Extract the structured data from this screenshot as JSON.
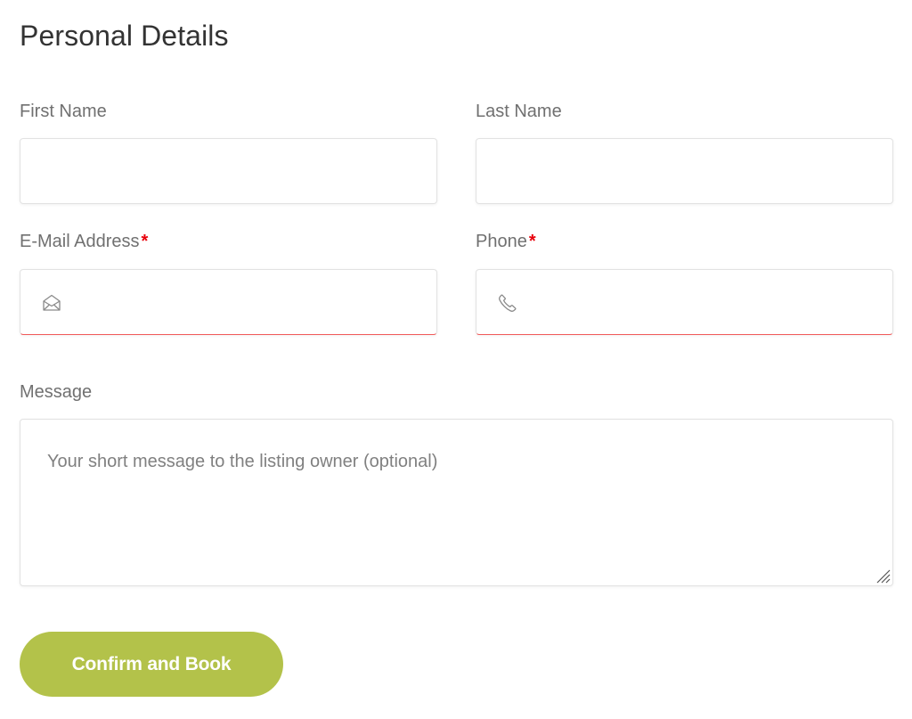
{
  "form": {
    "title": "Personal Details",
    "first_name": {
      "label": "First Name",
      "value": "",
      "placeholder": ""
    },
    "last_name": {
      "label": "Last Name",
      "value": "",
      "placeholder": ""
    },
    "email": {
      "label": "E-Mail Address",
      "required_mark": "*",
      "value": "",
      "placeholder": "",
      "icon": "envelope-icon"
    },
    "phone": {
      "label": "Phone",
      "required_mark": "*",
      "value": "",
      "placeholder": "",
      "icon": "phone-icon"
    },
    "message": {
      "label": "Message",
      "placeholder": "Your short message to the listing owner (optional)",
      "value": ""
    },
    "submit_label": "Confirm and Book"
  },
  "colors": {
    "accent": "#b3c24a",
    "required": "#e8000b",
    "invalid_border": "#f15a5a",
    "label": "#707070",
    "title": "#333333"
  }
}
